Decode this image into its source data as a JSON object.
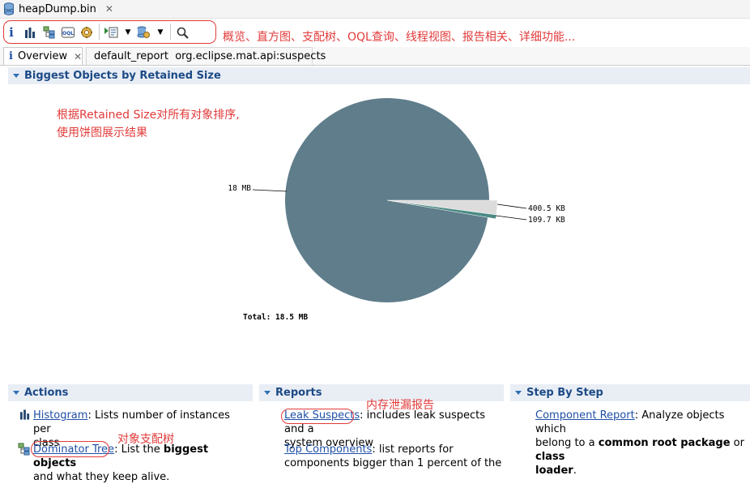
{
  "editor_tab": {
    "title": "heapDump.bin"
  },
  "toolbar": {
    "buttons": [
      "info-icon",
      "histogram-icon",
      "dominator-tree-icon",
      "oql-icon",
      "thread-overview-icon",
      "run-report-icon",
      "dropdown-icon",
      "query-browser-icon",
      "dropdown-icon",
      "search-icon"
    ],
    "oql_glyph": "OQL",
    "note": "概览、直方图、支配树、OQL查询、线程视图、报告相关、详细功能..."
  },
  "view_tabs": [
    {
      "label": "Overview"
    },
    {
      "label": "default_report  org.eclipse.mat.api:suspects"
    }
  ],
  "biggest_objects": {
    "header": "Biggest Objects by Retained Size",
    "note_lines": [
      "根据Retained Size对所有对象排序,",
      "使用饼图展示结果"
    ]
  },
  "chart_data": {
    "type": "pie",
    "unit": "MB",
    "slices": [
      {
        "label": "18 MB",
        "value": 18.0,
        "color": "#607d8b"
      },
      {
        "label": "400.5 KB",
        "value": 0.391,
        "color": "#dcdcdc"
      },
      {
        "label": "109.7 KB",
        "value": 0.107,
        "color": "#4a8a84"
      }
    ],
    "total_label": "Total: 18.5 MB"
  },
  "actions": {
    "header": "Actions",
    "items": [
      {
        "link": "Histogram",
        "text_1": ": Lists number of instances per",
        "text_2": "class"
      },
      {
        "link": "Dominator Tree",
        "text_a": ": List the ",
        "bold": "biggest objects",
        "text_2": "and what they keep alive."
      }
    ],
    "note": "对象支配树"
  },
  "reports": {
    "header": "Reports",
    "items": [
      {
        "link": "Leak Suspects",
        "text_1": ": includes leak suspects and a",
        "text_2": "system overview"
      },
      {
        "link": "Top Components",
        "text_1": ": list reports for",
        "text_2": "components bigger than 1 percent of the"
      }
    ],
    "note": "内存泄漏报告"
  },
  "step_by_step": {
    "header": "Step By Step",
    "items": [
      {
        "link": "Component Report",
        "text_1": ": Analyze objects which",
        "text_2a": "belong to a ",
        "bold_1": "common root package",
        "text_2b": " or ",
        "bold_2": "class",
        "bold_3": "loader",
        "text_3": "."
      }
    ]
  }
}
